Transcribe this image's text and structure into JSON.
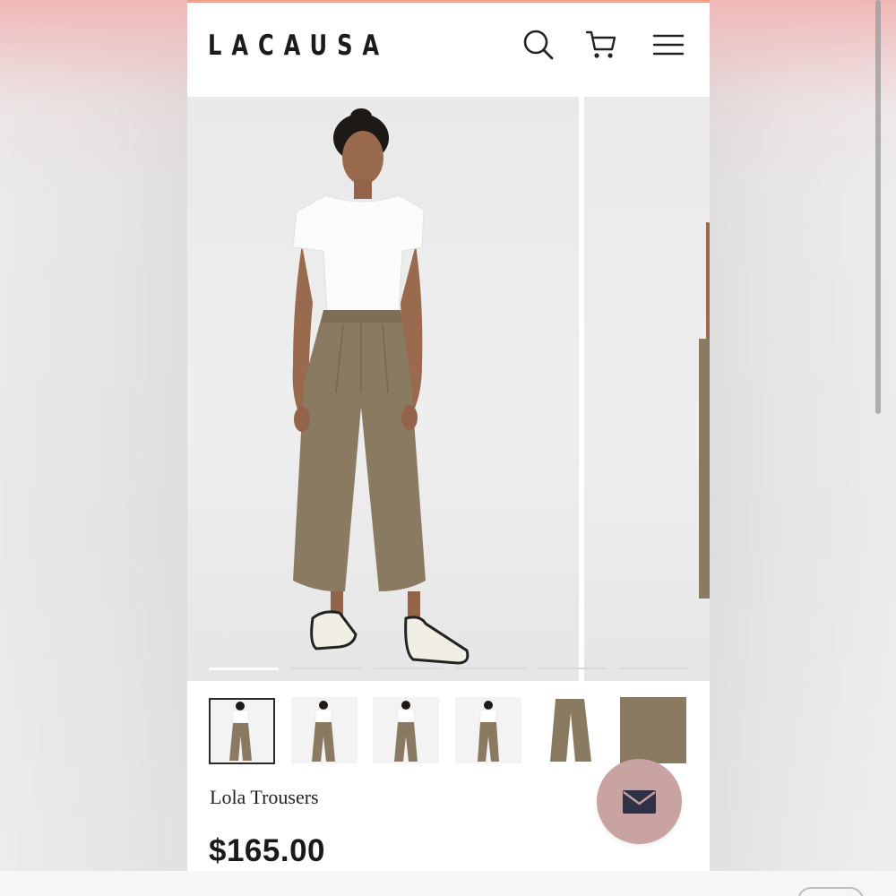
{
  "brand": {
    "logo_text": "LACAUSA"
  },
  "header": {
    "icons": [
      "search-icon",
      "cart-icon",
      "menu-icon"
    ]
  },
  "gallery": {
    "slide_count": 6,
    "active_slide": 1
  },
  "thumbnails": [
    {
      "name": "front-view",
      "selected": true
    },
    {
      "name": "back-view",
      "selected": false
    },
    {
      "name": "side-view",
      "selected": false
    },
    {
      "name": "back-detail-view",
      "selected": false
    },
    {
      "name": "flat-lay",
      "selected": false
    },
    {
      "name": "fabric-swatch",
      "selected": false
    }
  ],
  "product": {
    "name": "Lola Trousers",
    "price": "$165.00"
  },
  "floating_action": {
    "icon": "mail-icon"
  },
  "colors": {
    "accent_line": "#f0a08c",
    "fab": "#c9a2a2",
    "trouser": "#8a7a62",
    "logo": "#1b1b1b"
  }
}
